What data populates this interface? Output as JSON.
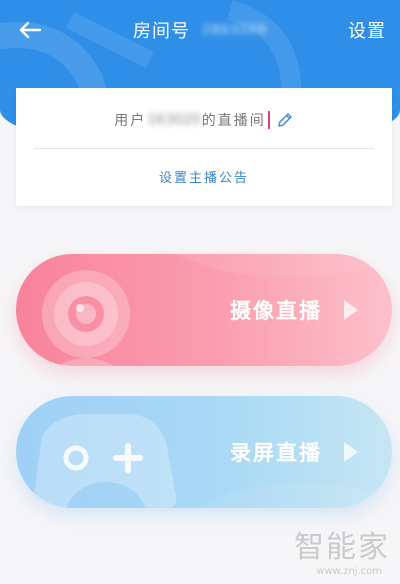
{
  "header": {
    "title": "房间号",
    "room_id": "2863509",
    "settings_label": "设置"
  },
  "card": {
    "room_name_prefix": "用户",
    "room_name_user": "163020",
    "room_name_suffix": "的直播间",
    "notice_label": "设置主播公告"
  },
  "modes": {
    "camera_label": "摄像直播",
    "screen_label": "录屏直播"
  },
  "watermark": {
    "main": "智能家",
    "sub": "www.znj.com"
  },
  "colors": {
    "header_blue": "#2f8fe8",
    "camera_pink": "#f8839a",
    "screen_blue": "#9fd0f7",
    "notice_text": "#3c86c8",
    "caret": "#e0466b"
  },
  "icons": {
    "back": "arrow-left-icon",
    "edit": "pencil-icon",
    "camera": "webcam-icon",
    "screen": "gamepad-icon",
    "arrow": "play-triangle-icon"
  }
}
